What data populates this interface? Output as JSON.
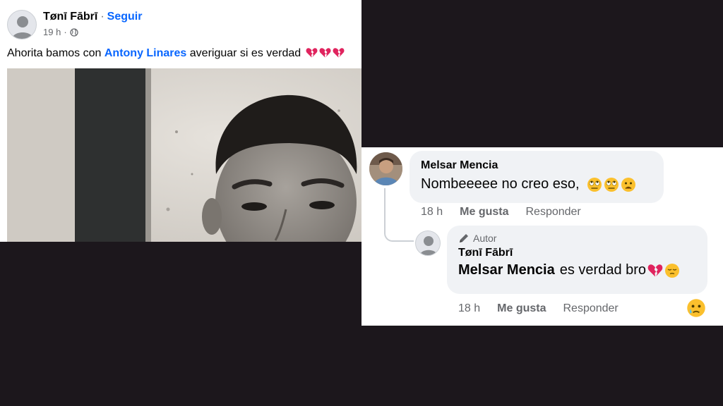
{
  "post": {
    "author": "Tønī Fābrī",
    "separator": "·",
    "follow_label": "Seguir",
    "time": "19 h",
    "separator2": "·",
    "text_before": "Ahorita bamos con",
    "mention": "Antony Linares",
    "text_after": "averiguar si es verdad"
  },
  "comment1": {
    "name": "Melsar Mencia",
    "text": "Nombeeeee no creo eso,",
    "time": "18 h",
    "like_label": "Me gusta",
    "reply_label": "Responder"
  },
  "comment2": {
    "badge": "Autor",
    "name": "Tønī Fābrī",
    "mention": "Melsar Mencia",
    "text": "es verdad bro",
    "time": "18 h",
    "like_label": "Me gusta",
    "reply_label": "Responder"
  },
  "colors": {
    "link_blue": "#0866ff",
    "secondary_text": "#65676b",
    "bubble_bg": "#f0f2f5",
    "background": "#1c171c"
  },
  "icons": {
    "globe": "globe-icon",
    "broken_heart": "broken-heart-emoji",
    "rolling_eyes": "rolling-eyes-emoji",
    "frowning": "frowning-face-emoji",
    "relieved": "pensive-face-emoji",
    "crying": "sad-tear-face-emoji",
    "pencil": "pencil-icon"
  }
}
